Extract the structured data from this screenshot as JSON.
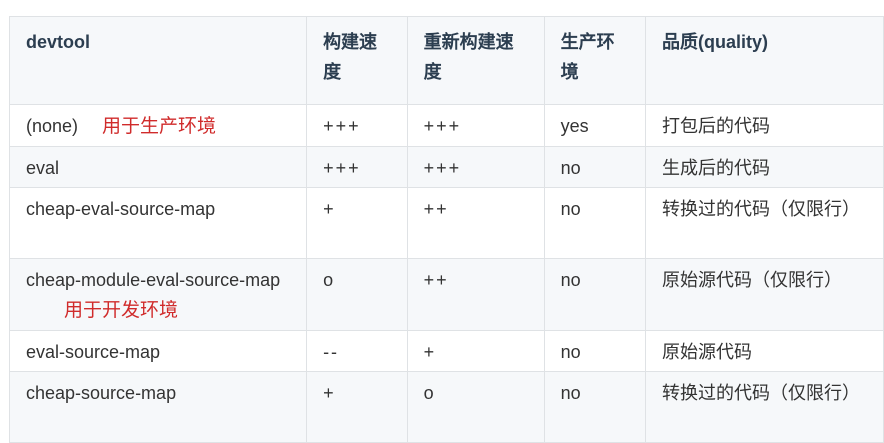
{
  "table": {
    "headers": [
      "devtool",
      "构建速度",
      "重新构建速度",
      "生产环境",
      "品质(quality)"
    ],
    "rows": [
      {
        "devtool": "(none)",
        "note": "用于生产环境",
        "build": "+++",
        "rebuild": "+++",
        "production": "yes",
        "quality": "打包后的代码"
      },
      {
        "devtool": "eval",
        "note": "",
        "build": "+++",
        "rebuild": "+++",
        "production": "no",
        "quality": "生成后的代码"
      },
      {
        "devtool": "cheap-eval-source-map",
        "note": "",
        "build": "+",
        "rebuild": "++",
        "production": "no",
        "quality": "转换过的代码（仅限行）"
      },
      {
        "devtool": "cheap-module-eval-source-map",
        "note": "用于开发环境",
        "build": "o",
        "rebuild": "++",
        "production": "no",
        "quality": "原始源代码（仅限行）"
      },
      {
        "devtool": "eval-source-map",
        "note": "",
        "build": "--",
        "rebuild": "+",
        "production": "no",
        "quality": "原始源代码"
      },
      {
        "devtool": "cheap-source-map",
        "note": "",
        "build": "+",
        "rebuild": "o",
        "production": "no",
        "quality": "转换过的代码（仅限行）"
      }
    ]
  },
  "colors": {
    "header_bg": "#f6f8fa",
    "border": "#dfe2e5",
    "note": "#d02b2b"
  }
}
